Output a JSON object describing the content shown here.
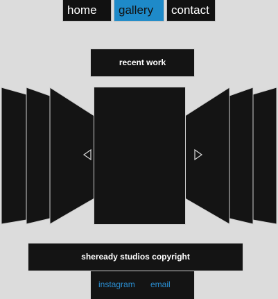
{
  "nav": {
    "home_label": "home",
    "gallery_label": "gallery",
    "contact_label": "contact",
    "active_color": "#1e8ac9"
  },
  "section": {
    "title": "recent work"
  },
  "carousel": {
    "prev_icon": "triangle-left-icon",
    "next_icon": "triangle-right-icon",
    "visible_items": 7
  },
  "footer": {
    "copyright": "sheready studios copyright",
    "instagram_label": "instagram",
    "email_label": "email",
    "link_color": "#2a8fd4"
  }
}
